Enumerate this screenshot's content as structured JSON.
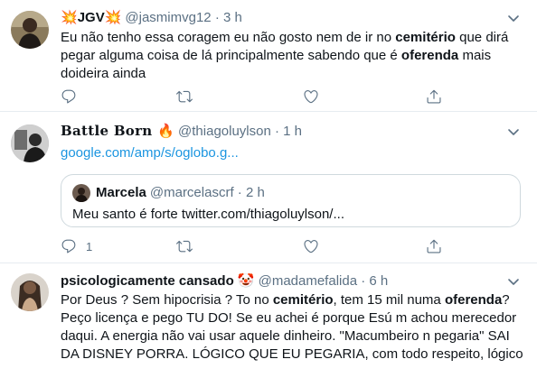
{
  "tweets": [
    {
      "display_name": "JGV",
      "name_emoji_left": "💥",
      "name_emoji_right": "💥",
      "handle": "@jasmimvg12",
      "separator": "·",
      "time": "3 h",
      "text_parts": [
        "Eu não tenho essa coragem eu não gosto nem de ir no ",
        "cemitério",
        " que dirá pegar alguma coisa de lá principalmente sabendo que é ",
        "oferenda",
        " mais doideira ainda"
      ]
    },
    {
      "display_name": "Battle Born",
      "name_emoji": "🔥",
      "handle": "@thiagoluylson",
      "separator": "·",
      "time": "1 h",
      "link": "google.com/amp/s/oglobo.g...",
      "quote": {
        "display_name": "Marcela",
        "handle": "@marcelascrf",
        "separator": "·",
        "time": "2 h",
        "text": "Meu santo é forte twitter.com/thiagoluylson/..."
      },
      "reply_count": "1"
    },
    {
      "display_name": "psicologicamente cansado",
      "name_emoji": "🤡",
      "handle": "@madamefalida",
      "separator": "·",
      "time": "6 h",
      "text_parts": [
        "Por Deus ? Sem hipocrisia ? To no ",
        "cemitério",
        ", tem 15 mil numa ",
        "oferenda",
        "? Peço licença e pego TU DO! Se eu achei é porque Esú m achou merecedor daqui. A energia não vai usar aquele dinheiro. \"Macumbeiro n pegaria\" SAI DA DISNEY PORRA. LÓGICO QUE EU PEGARIA, com todo respeito, lógico"
      ]
    }
  ],
  "colors": {
    "text": "#0f1419",
    "secondary": "#5b7083",
    "link": "#1b95e0",
    "border": "#e6ecf0"
  },
  "icons": [
    "reply-icon",
    "retweet-icon",
    "like-icon",
    "share-icon",
    "more-options-icon"
  ]
}
